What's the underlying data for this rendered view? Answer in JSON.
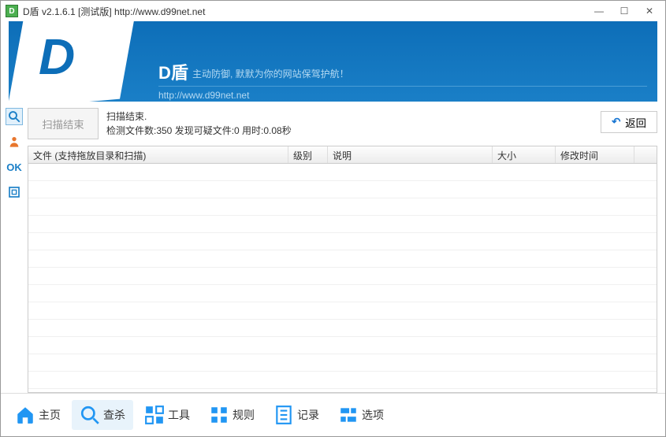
{
  "titlebar": {
    "app_icon_letter": "D",
    "title": "D盾 v2.1.6.1 [测试版] http://www.d99net.net"
  },
  "banner": {
    "logo_letter": "D",
    "name": "D盾",
    "slogan": "主动防御, 默默为你的网站保驾护航！",
    "url": "http://www.d99net.net"
  },
  "sidebar": {
    "ok_label": "OK"
  },
  "actions": {
    "scan_end_btn": "扫描结束",
    "back_btn": "返回"
  },
  "status": {
    "line1": "扫描结束.",
    "line2": "检测文件数:350 发现可疑文件:0 用时:0.08秒"
  },
  "table": {
    "columns": {
      "file": "文件 (支持拖放目录和扫描)",
      "level": "级别",
      "desc": "说明",
      "size": "大小",
      "date": "修改时间"
    },
    "rows": []
  },
  "nav": {
    "home": "主页",
    "scan": "查杀",
    "tools": "工具",
    "rules": "规则",
    "logs": "记录",
    "options": "选项"
  }
}
